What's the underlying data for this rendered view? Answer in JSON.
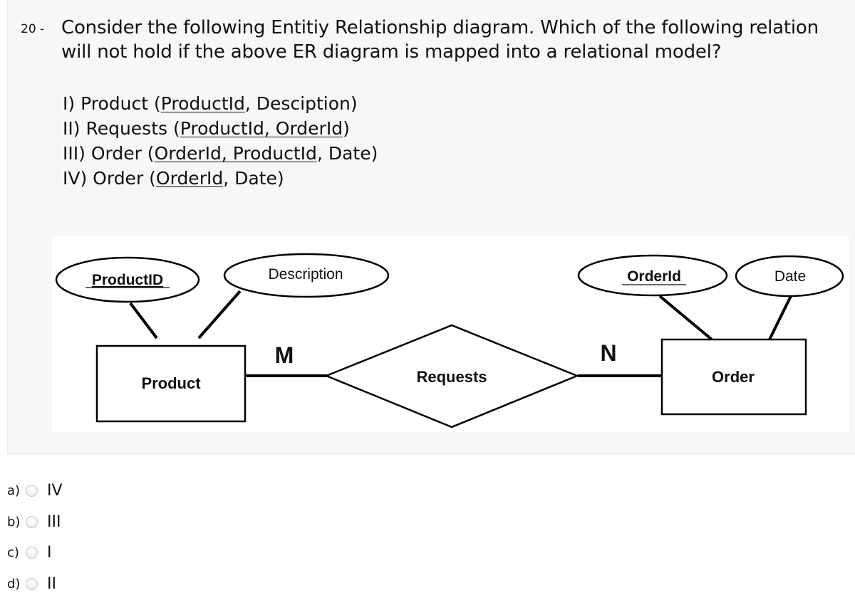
{
  "question": {
    "number": "20 -",
    "text": "Consider the following Entitiy Relationship diagram. Which of the following relation will not hold if the above ER diagram is mapped into a relational model?",
    "relations": [
      {
        "prefix": "I) Product (",
        "key": "ProductId",
        "rest": ", Desciption)"
      },
      {
        "prefix": "II) Requests (",
        "key": "ProductId, OrderId",
        "rest": ")"
      },
      {
        "prefix": "III) Order (",
        "key": "OrderId, ProductId",
        "rest": ", Date)"
      },
      {
        "prefix": "IV) Order (",
        "key": "OrderId",
        "rest": ", Date)"
      }
    ]
  },
  "diagram": {
    "entities": [
      {
        "id": "product",
        "label": "Product"
      },
      {
        "id": "order",
        "label": "Order"
      }
    ],
    "relationship": {
      "label": "Requests"
    },
    "attributes": [
      {
        "label": "ProductID",
        "key": true,
        "entity": "product"
      },
      {
        "label": "Description",
        "key": false,
        "entity": "product"
      },
      {
        "label": "OrderId",
        "key": true,
        "entity": "order"
      },
      {
        "label": "Date",
        "key": false,
        "entity": "order"
      }
    ],
    "cardinality": {
      "left": "M",
      "right": "N"
    }
  },
  "options": [
    {
      "letter": "a)",
      "text": "IV",
      "selected": false
    },
    {
      "letter": "b)",
      "text": "III",
      "selected": false
    },
    {
      "letter": "c)",
      "text": "I",
      "selected": false
    },
    {
      "letter": "d)",
      "text": "II",
      "selected": false
    }
  ]
}
